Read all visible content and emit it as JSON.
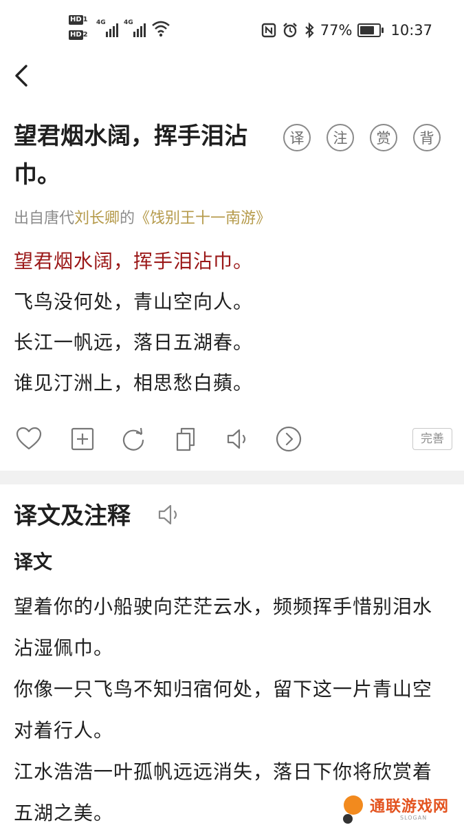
{
  "status_bar": {
    "sim1": "HD",
    "sim1_num": "1",
    "sim2": "HD",
    "sim2_num": "2",
    "net1": "4G",
    "net2": "4G",
    "battery_pct": "77%",
    "battery_level": 0.77,
    "time": "10:37"
  },
  "poem": {
    "title": "望君烟水阔，挥手泪沾巾。",
    "tools": [
      "译",
      "注",
      "赏",
      "背"
    ],
    "source": {
      "prefix": "出自唐代",
      "author": "刘长卿",
      "middle": "的",
      "work": "《饯别王十一南游》"
    },
    "lines": [
      "望君烟水阔，挥手泪沾巾。",
      "飞鸟没何处，青山空向人。",
      "长江一帆远，落日五湖春。",
      "谁见汀洲上，相思愁白蘋。"
    ]
  },
  "toolbar": {
    "perfect_label": "完善"
  },
  "translation": {
    "section_title": "译文及注释",
    "subtitle": "译文",
    "paragraphs": [
      "望着你的小船驶向茫茫云水，频频挥手惜别泪水沾湿佩巾。",
      "你像一只飞鸟不知归宿何处，留下这一片青山空对着行人。",
      "江水浩浩一叶孤帆远远消失，落日下你将欣赏着五湖之美。"
    ]
  },
  "watermark": {
    "text": "通联游戏网",
    "sub": "SLOGAN"
  },
  "colors": {
    "highlight": "#9a1717",
    "gold": "#b59a4a",
    "watermark": "#e3531f"
  }
}
